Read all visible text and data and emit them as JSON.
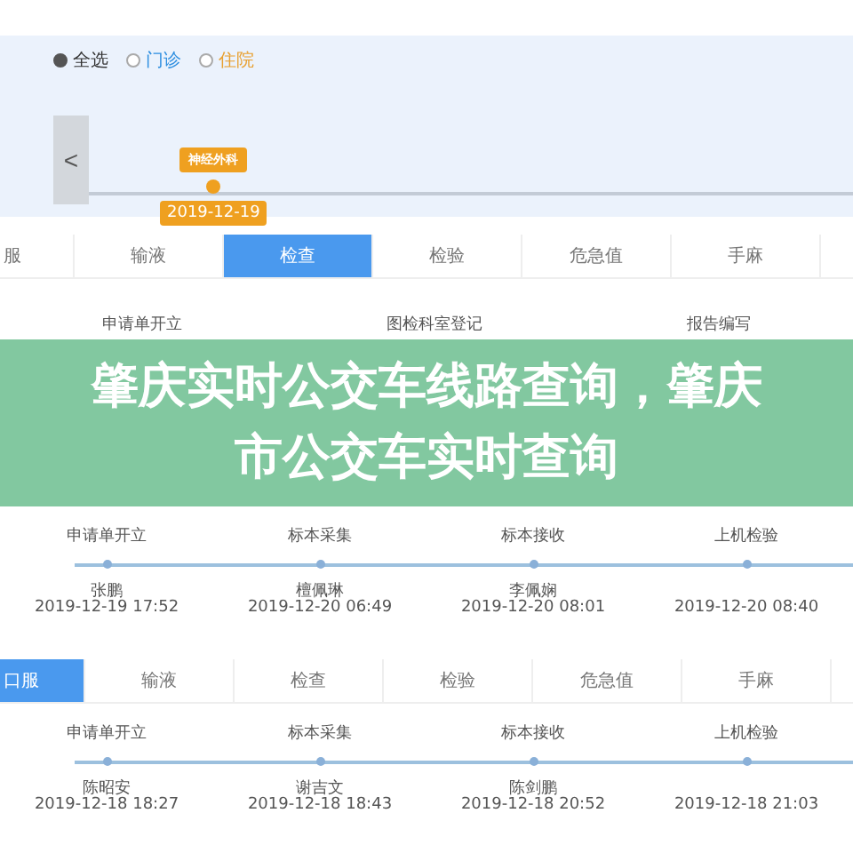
{
  "filter": {
    "radios": [
      {
        "label": "全选",
        "selected": true,
        "color": "#333333"
      },
      {
        "label": "门诊",
        "selected": false,
        "color": "#2f8fe0"
      },
      {
        "label": "住院",
        "selected": false,
        "color": "#e8a030"
      }
    ],
    "timeline": {
      "back": "<",
      "department": "神经外科",
      "date": "2019-12-19"
    }
  },
  "tabs_1": [
    {
      "label": "服",
      "selected": false
    },
    {
      "label": "输液",
      "selected": false
    },
    {
      "label": "检查",
      "selected": true
    },
    {
      "label": "检验",
      "selected": false
    },
    {
      "label": "危急值",
      "selected": false
    },
    {
      "label": "手麻",
      "selected": false
    }
  ],
  "steps_1": [
    "申请单开立",
    "图检科室登记",
    "报告编写"
  ],
  "banner": {
    "title": "肇庆实时公交车线路查询，肇庆市公交车实时查询"
  },
  "steps_2": [
    {
      "label": "申请单开立",
      "person": "张鹏",
      "time": "2019-12-19 17:52"
    },
    {
      "label": "标本采集",
      "person": "檀佩琳",
      "time": "2019-12-20 06:49"
    },
    {
      "label": "标本接收",
      "person": "李佩娴",
      "time": "2019-12-20 08:01"
    },
    {
      "label": "上机检验",
      "time": "2019-12-20 08:40"
    }
  ],
  "tabs_2": [
    {
      "label": "口服",
      "selected": true
    },
    {
      "label": "输液",
      "selected": false
    },
    {
      "label": "检查",
      "selected": false
    },
    {
      "label": "检验",
      "selected": false
    },
    {
      "label": "危急值",
      "selected": false
    },
    {
      "label": "手麻",
      "selected": false
    }
  ],
  "steps_3": [
    {
      "label": "申请单开立",
      "person": "陈昭安",
      "time": "2019-12-18 18:27"
    },
    {
      "label": "标本采集",
      "person": "谢吉文",
      "time": "2019-12-18 18:43"
    },
    {
      "label": "标本接收",
      "person": "陈剑鹏",
      "time": "2019-12-18 20:52"
    },
    {
      "label": "上机检验",
      "time": "2019-12-18 21:03"
    }
  ]
}
